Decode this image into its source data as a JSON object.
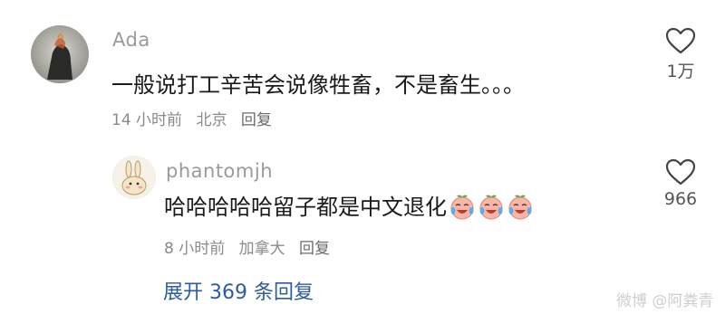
{
  "comments": [
    {
      "username": "Ada",
      "text": "一般说打工辛苦会说像牲畜，不是畜生。。。",
      "time": "14 小时前",
      "location": "北京",
      "reply_label": "回复",
      "likes": "1万"
    }
  ],
  "reply": {
    "username": "phantomjh",
    "text": "哈哈哈哈哈留子都是中文退化",
    "emoji_count": 3,
    "time": "8 小时前",
    "location": "加拿大",
    "reply_label": "回复",
    "likes": "966"
  },
  "expand_replies": "展开 369 条回复",
  "watermark": "微博 @阿粪青",
  "icons": {
    "like": "heart-outline-icon",
    "emoji": "crying-laughing-peach-emoji",
    "watermark_logo": "weibo-logo-icon"
  },
  "colors": {
    "link": "#2d5d9a",
    "meta": "#8a8a8a",
    "username": "#9a9a9a"
  }
}
